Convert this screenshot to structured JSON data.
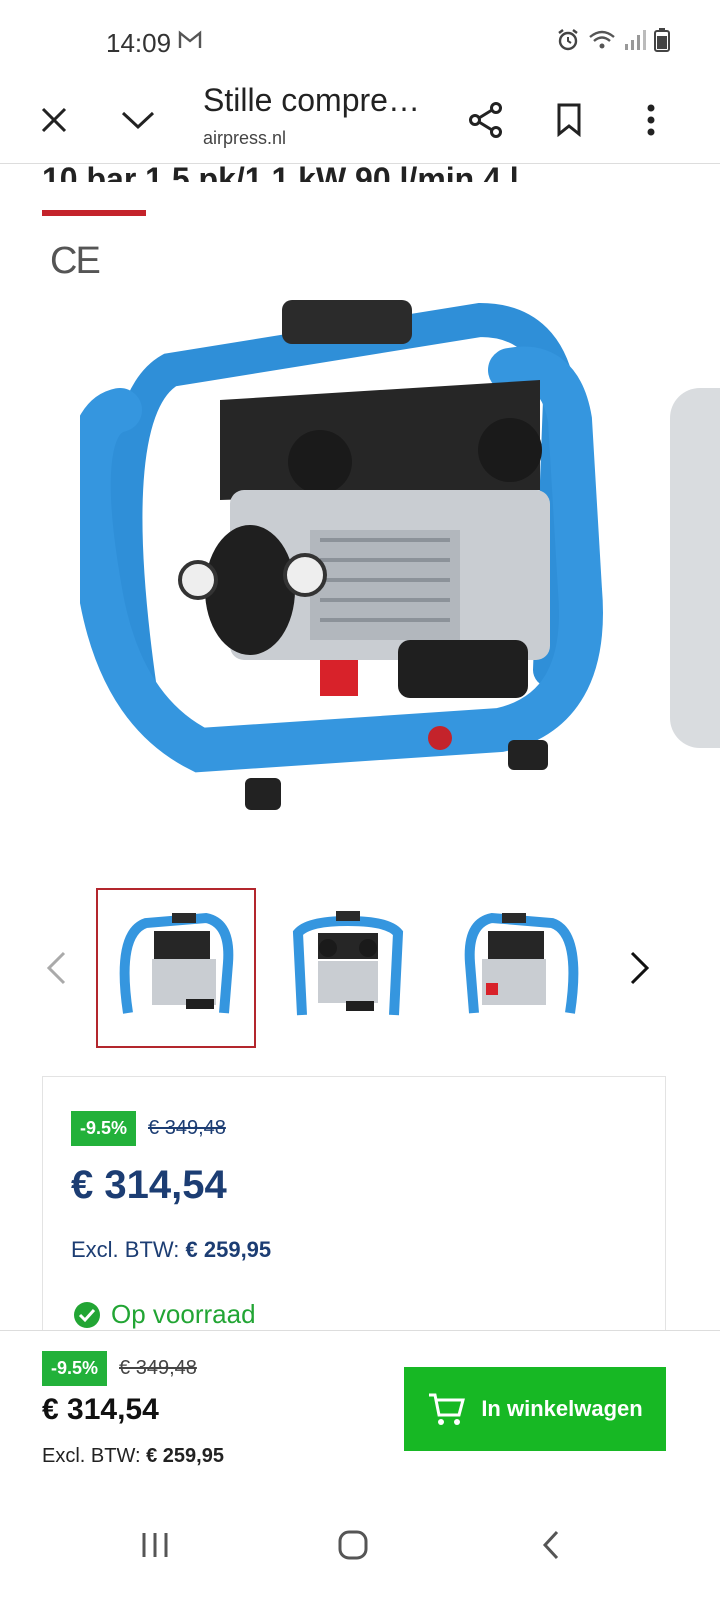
{
  "status_bar": {
    "time": "14:09",
    "icons": [
      "gmail-icon",
      "alarm-icon",
      "wifi-icon",
      "signal-icon",
      "battery-icon"
    ]
  },
  "toolbar": {
    "title": "Stille compre…",
    "url": "airpress.nl",
    "icons": [
      "close-icon",
      "chevron-down-icon",
      "share-icon",
      "bookmark-icon",
      "more-vert-icon"
    ]
  },
  "product": {
    "heading_partial": "10 bar 1.5 pk/1.1 kW 90 l/min 4 l",
    "ce_mark": "CE",
    "thumbnails_count": 3,
    "active_thumbnail": 0
  },
  "price_card": {
    "discount_badge": "-9.5%",
    "old_price": "€ 349,48",
    "price": "€ 314,54",
    "excl_label": "Excl. BTW:",
    "excl_value": "€ 259,95",
    "stock_text": "Op voorraad"
  },
  "sticky_bar": {
    "discount_badge": "-9.5%",
    "old_price": "€ 349,48",
    "price": "€ 314,54",
    "excl_label": "Excl. BTW:",
    "excl_value": "€ 259,95",
    "cart_button_label": "In winkelwagen"
  },
  "colors": {
    "accent_red": "#c4232b",
    "price_blue": "#1c3d73",
    "green": "#17b824",
    "product_blue": "#2f8fd8"
  }
}
